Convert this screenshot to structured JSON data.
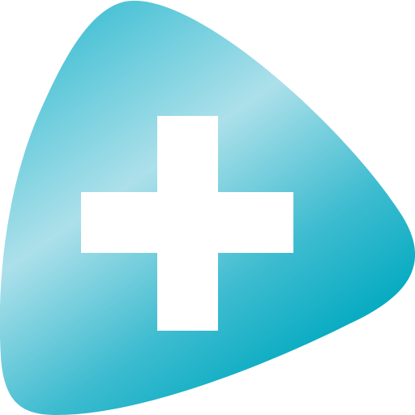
{
  "icon": {
    "name": "medical-cross-app-icon",
    "shape": "rounded-triangle",
    "symbol": "plus-cross",
    "colors": {
      "gradient_dark": "#00A9C0",
      "gradient_light": "#ACE0EA",
      "gradient_mid": "#4CC3D6",
      "cross": "#FFFFFF",
      "background": "#FFFFFF"
    }
  }
}
